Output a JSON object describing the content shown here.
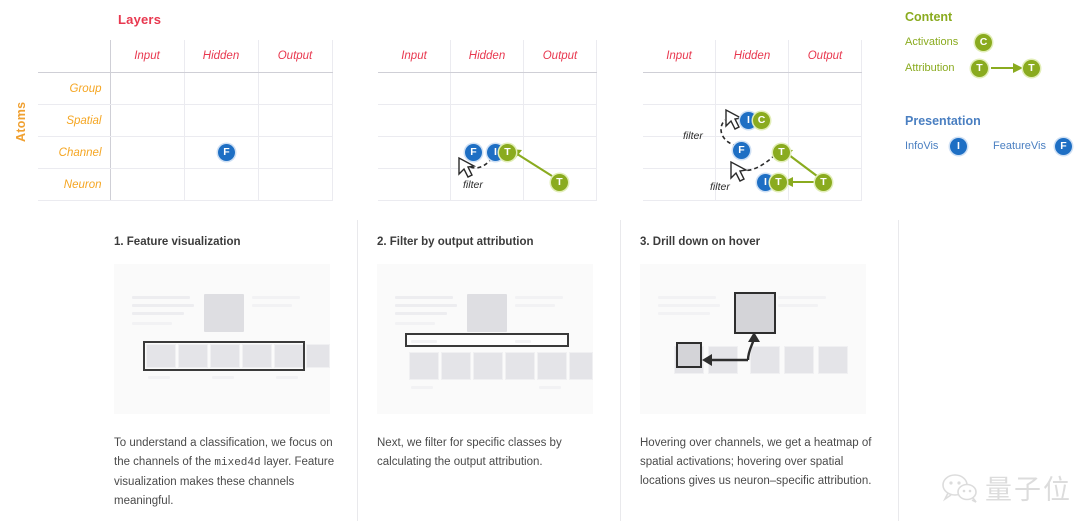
{
  "matrices": [
    {
      "title": "Layers",
      "y_axis_label": "Atoms",
      "columns": [
        "Input",
        "Hidden",
        "Output"
      ],
      "rows": [
        "Group",
        "Spatial",
        "Channel",
        "Neuron"
      ],
      "show_labels": true,
      "badges": [
        {
          "text": "F",
          "kind": "blue",
          "row": "Channel",
          "col": "Hidden"
        }
      ],
      "filter_labels": [],
      "arrows": []
    },
    {
      "title": "",
      "y_axis_label": "",
      "columns": [
        "Input",
        "Hidden",
        "Output"
      ],
      "rows": [
        "Group",
        "Spatial",
        "Channel",
        "Neuron"
      ],
      "show_labels": false,
      "badges": [
        {
          "text": "F",
          "kind": "blue",
          "row": "Channel",
          "col": "Hidden"
        },
        {
          "text": "I",
          "kind": "blue",
          "row": "Channel",
          "col": "Hidden"
        },
        {
          "text": "T",
          "kind": "olive",
          "row": "Channel",
          "col": "Hidden"
        },
        {
          "text": "T",
          "kind": "olive",
          "row": "Neuron",
          "col": "Output"
        }
      ],
      "filter_labels": [
        "filter"
      ],
      "arrows": [
        "cursor-dashed-filter",
        "olive-attribution"
      ]
    },
    {
      "title": "",
      "y_axis_label": "",
      "columns": [
        "Input",
        "Hidden",
        "Output"
      ],
      "rows": [
        "Group",
        "Spatial",
        "Channel",
        "Neuron"
      ],
      "show_labels": false,
      "badges": [
        {
          "text": "I",
          "kind": "blue",
          "row": "Spatial",
          "col": "Hidden"
        },
        {
          "text": "C",
          "kind": "olive",
          "row": "Spatial",
          "col": "Hidden"
        },
        {
          "text": "F",
          "kind": "blue",
          "row": "Channel",
          "col": "Hidden"
        },
        {
          "text": "T",
          "kind": "olive",
          "row": "Channel",
          "col": "Hidden"
        },
        {
          "text": "I",
          "kind": "blue",
          "row": "Neuron",
          "col": "Hidden"
        },
        {
          "text": "T",
          "kind": "olive",
          "row": "Neuron",
          "col": "Hidden"
        },
        {
          "text": "T",
          "kind": "olive",
          "row": "Neuron",
          "col": "Output"
        }
      ],
      "filter_labels": [
        "filter",
        "filter"
      ],
      "arrows": [
        "cursor-dashed-filter-upper",
        "cursor-dashed-filter-lower",
        "olive-attribution-a",
        "olive-attribution-b"
      ]
    }
  ],
  "legend": {
    "content": {
      "heading": "Content",
      "items": [
        {
          "label": "Activations",
          "badges": [
            "C"
          ],
          "kind": "olive",
          "arrow": false
        },
        {
          "label": "Attribution",
          "badges": [
            "T",
            "T"
          ],
          "kind": "olive",
          "arrow": true
        }
      ]
    },
    "presentation": {
      "heading": "Presentation",
      "items": [
        {
          "label": "InfoVis",
          "badge": "I",
          "kind": "blue"
        },
        {
          "label": "FeatureVis",
          "badge": "F",
          "kind": "blue"
        }
      ]
    }
  },
  "panels": [
    {
      "heading": "1. Feature visualization",
      "caption_parts": [
        {
          "text": "To understand a classification, we focus on the channels of the ",
          "mono": false
        },
        {
          "text": "mixed4d",
          "mono": true
        },
        {
          "text": " layer. Feature visualization makes these channels meaningful.",
          "mono": false
        }
      ],
      "annotation": "highlight-thumbnail-row"
    },
    {
      "heading": "2. Filter by output attribution",
      "caption_parts": [
        {
          "text": "Next, we filter for specific classes by calculating the output attribution.",
          "mono": false
        }
      ],
      "annotation": "highlight-filter-bar"
    },
    {
      "heading": "3. Drill down on hover",
      "caption_parts": [
        {
          "text": "Hovering over channels, we get a heatmap of spatial activations; hovering over spatial locations gives us neuron–specific attribution.",
          "mono": false
        }
      ],
      "annotation": "zoom-callout-arrows"
    }
  ],
  "watermark": {
    "icon": "wechat-icon",
    "text": "量子位"
  },
  "colors": {
    "layers_title": "#e8384f",
    "column_header": "#e8384f",
    "row_label": "#f5a623",
    "axis_label": "#f0a030",
    "content_olive": "#8aab1f",
    "presentation_blue": "#4a7fc1",
    "badge_blue": "#1e6fc4",
    "badge_olive": "#8aab1f",
    "caption_text": "#4a4a4a"
  }
}
